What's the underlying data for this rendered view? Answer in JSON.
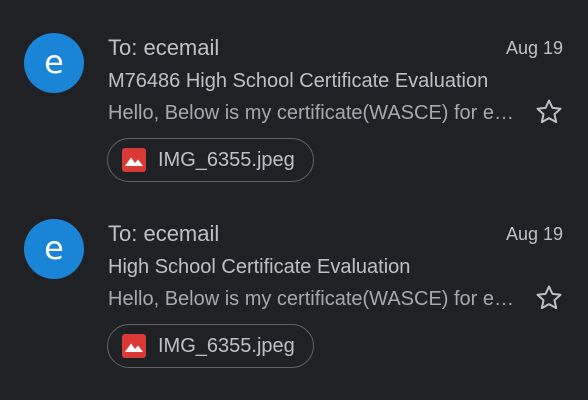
{
  "colors": {
    "background": "#202124",
    "avatar": "#1a84d6",
    "attachment_icon": "#d93a35",
    "text": "#bdc1c6"
  },
  "emails": [
    {
      "avatar_letter": "e",
      "sender": "To: ecemail",
      "date": "Aug 19",
      "subject": "M76486 High School Certificate Evaluation",
      "snippet": "Hello, Below is my certificate(WASCE) for evaluation",
      "starred": false,
      "attachment": {
        "icon": "image-icon",
        "filename": "IMG_6355.jpeg"
      }
    },
    {
      "avatar_letter": "e",
      "sender": "To: ecemail",
      "date": "Aug 19",
      "subject": "High School Certificate Evaluation",
      "snippet": "Hello, Below is my certificate(WASCE) for evaluation",
      "starred": false,
      "attachment": {
        "icon": "image-icon",
        "filename": "IMG_6355.jpeg"
      }
    }
  ]
}
